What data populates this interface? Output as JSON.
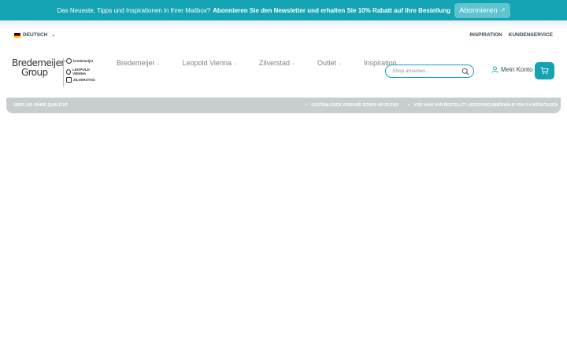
{
  "announcement": {
    "text_plain": "Das Neueste, Tipps und Inspirationen in Ihrer Mailbox?",
    "text_strong": "Abonnieren Sie den Newsletter und erhalten Sie 10% Rabatt auf Ihre Bestellung",
    "button_label": "Abonnieren"
  },
  "utility": {
    "language": "DEUTSCH",
    "links": [
      "INSPIRATION",
      "KUNDENSERVICE"
    ]
  },
  "logo": {
    "main_line1": "Bredemeijer",
    "main_line2": "Group",
    "brands": [
      "bredemeijer",
      "LEOPOLD VIENNA",
      "ZILVERSTAD"
    ]
  },
  "nav": {
    "items": [
      {
        "label": "Bredemeijer",
        "has_dropdown": true
      },
      {
        "label": "Leopold Vienna",
        "has_dropdown": true
      },
      {
        "label": "Zilverstad",
        "has_dropdown": true
      },
      {
        "label": "Outlet",
        "has_dropdown": true
      },
      {
        "label": "Inspiration",
        "has_dropdown": false
      }
    ]
  },
  "search": {
    "placeholder": "Shop ansehen..."
  },
  "account": {
    "label": "Mein Konto"
  },
  "usp": {
    "left": "ÜBER 100 JAHRE QUALITÄT",
    "right1": "KOSTENLOSER VERSAND SCHON AB 50 EUR",
    "right2": "VOR 14:00 UHR BESTELLT? LIEFERUNG INNERHALB VON 3-4 WERKTAGEN"
  },
  "colors": {
    "accent": "#14a3b3",
    "usp_bg": "#c8cdcf",
    "text_dark": "#3a4a55"
  }
}
